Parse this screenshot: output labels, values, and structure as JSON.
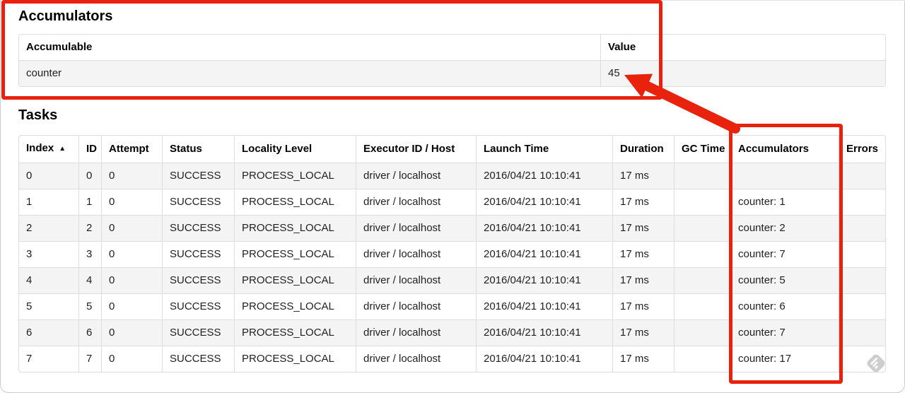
{
  "theme": {
    "annotation-red": "#e8220d",
    "table-border": "#dddddd",
    "row-stripe": "#f4f4f4",
    "text": "#1f1f1f"
  },
  "accumulators_section": {
    "title": "Accumulators",
    "table": {
      "columns": [
        "Accumulable",
        "Value"
      ],
      "rows": [
        {
          "accumulable": "counter",
          "value": "45"
        }
      ]
    }
  },
  "tasks_section": {
    "title": "Tasks",
    "table": {
      "columns": [
        "Index",
        "ID",
        "Attempt",
        "Status",
        "Locality Level",
        "Executor ID / Host",
        "Launch Time",
        "Duration",
        "GC Time",
        "Accumulators",
        "Errors"
      ],
      "fields": [
        "index",
        "id",
        "attempt",
        "status",
        "locality_level",
        "executor_id_host",
        "launch_time",
        "duration",
        "gc_time",
        "accumulators",
        "errors"
      ],
      "sort_column": "Index",
      "sort_icon": "▲",
      "rows": [
        {
          "index": "0",
          "id": "0",
          "attempt": "0",
          "status": "SUCCESS",
          "locality_level": "PROCESS_LOCAL",
          "executor_id_host": "driver / localhost",
          "launch_time": "2016/04/21 10:10:41",
          "duration": "17 ms",
          "gc_time": "",
          "accumulators": "",
          "errors": ""
        },
        {
          "index": "1",
          "id": "1",
          "attempt": "0",
          "status": "SUCCESS",
          "locality_level": "PROCESS_LOCAL",
          "executor_id_host": "driver / localhost",
          "launch_time": "2016/04/21 10:10:41",
          "duration": "17 ms",
          "gc_time": "",
          "accumulators": "counter: 1",
          "errors": ""
        },
        {
          "index": "2",
          "id": "2",
          "attempt": "0",
          "status": "SUCCESS",
          "locality_level": "PROCESS_LOCAL",
          "executor_id_host": "driver / localhost",
          "launch_time": "2016/04/21 10:10:41",
          "duration": "17 ms",
          "gc_time": "",
          "accumulators": "counter: 2",
          "errors": ""
        },
        {
          "index": "3",
          "id": "3",
          "attempt": "0",
          "status": "SUCCESS",
          "locality_level": "PROCESS_LOCAL",
          "executor_id_host": "driver / localhost",
          "launch_time": "2016/04/21 10:10:41",
          "duration": "17 ms",
          "gc_time": "",
          "accumulators": "counter: 7",
          "errors": ""
        },
        {
          "index": "4",
          "id": "4",
          "attempt": "0",
          "status": "SUCCESS",
          "locality_level": "PROCESS_LOCAL",
          "executor_id_host": "driver / localhost",
          "launch_time": "2016/04/21 10:10:41",
          "duration": "17 ms",
          "gc_time": "",
          "accumulators": "counter: 5",
          "errors": ""
        },
        {
          "index": "5",
          "id": "5",
          "attempt": "0",
          "status": "SUCCESS",
          "locality_level": "PROCESS_LOCAL",
          "executor_id_host": "driver / localhost",
          "launch_time": "2016/04/21 10:10:41",
          "duration": "17 ms",
          "gc_time": "",
          "accumulators": "counter: 6",
          "errors": ""
        },
        {
          "index": "6",
          "id": "6",
          "attempt": "0",
          "status": "SUCCESS",
          "locality_level": "PROCESS_LOCAL",
          "executor_id_host": "driver / localhost",
          "launch_time": "2016/04/21 10:10:41",
          "duration": "17 ms",
          "gc_time": "",
          "accumulators": "counter: 7",
          "errors": ""
        },
        {
          "index": "7",
          "id": "7",
          "attempt": "0",
          "status": "SUCCESS",
          "locality_level": "PROCESS_LOCAL",
          "executor_id_host": "driver / localhost",
          "launch_time": "2016/04/21 10:10:41",
          "duration": "17 ms",
          "gc_time": "",
          "accumulators": "counter: 17",
          "errors": ""
        }
      ]
    }
  },
  "annotations": {
    "color": "#e8220d",
    "box_around": [
      "accumulators-summary-table",
      "tasks-accumulators-column"
    ],
    "arrow_from": "tasks-accumulators-column",
    "arrow_to": "accumulator-total-value-45"
  },
  "watermark": {
    "icon": "feedly-style-logo"
  }
}
